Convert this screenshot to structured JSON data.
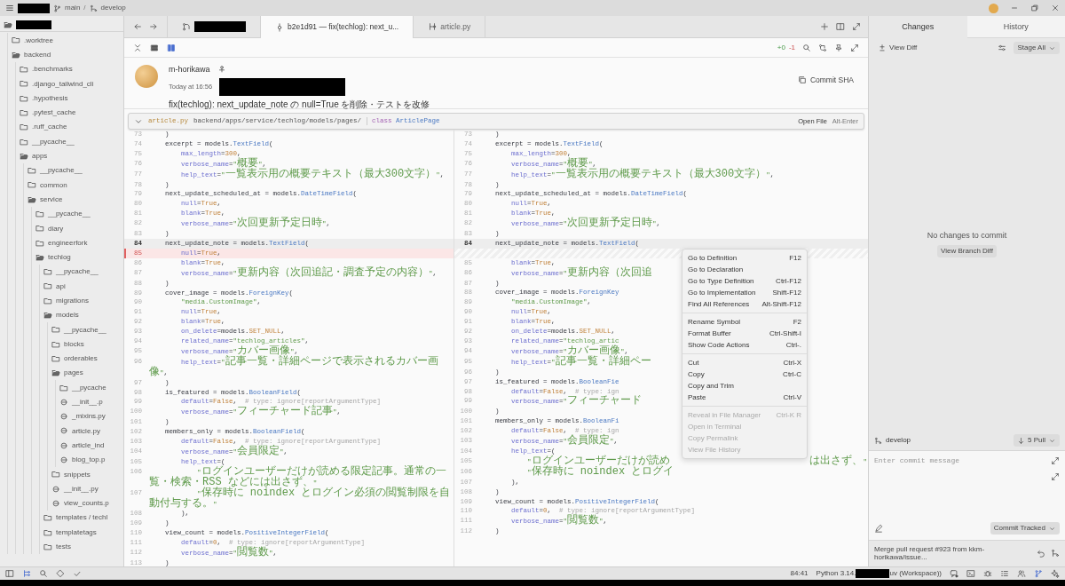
{
  "title_bar": {
    "branches": [
      {
        "name": "main",
        "kind": "current"
      },
      {
        "name": "develop",
        "kind": "upstream"
      }
    ],
    "separator": "/"
  },
  "project_tree": {
    "root": {
      "expanded": true,
      "children": [
        {
          "name": ".worktree",
          "kind": "folder",
          "expanded": false
        },
        {
          "name": "backend",
          "kind": "folder",
          "expanded": true,
          "children": [
            {
              "name": ".benchmarks",
              "kind": "folder",
              "expanded": false
            },
            {
              "name": ".django_tailwind_cli",
              "kind": "folder",
              "expanded": false
            },
            {
              "name": ".hypothesis",
              "kind": "folder",
              "expanded": false
            },
            {
              "name": ".pytest_cache",
              "kind": "folder",
              "expanded": false
            },
            {
              "name": ".ruff_cache",
              "kind": "folder",
              "expanded": false
            },
            {
              "name": "__pycache__",
              "kind": "folder",
              "expanded": false
            },
            {
              "name": "apps",
              "kind": "folder",
              "expanded": true,
              "children": [
                {
                  "name": "__pycache__",
                  "kind": "folder",
                  "expanded": false
                },
                {
                  "name": "common",
                  "kind": "folder",
                  "expanded": false
                },
                {
                  "name": "service",
                  "kind": "folder",
                  "expanded": true,
                  "children": [
                    {
                      "name": "__pycache__",
                      "kind": "folder",
                      "expanded": false
                    },
                    {
                      "name": "diary",
                      "kind": "folder",
                      "expanded": false
                    },
                    {
                      "name": "engineerfork",
                      "kind": "folder",
                      "expanded": false
                    },
                    {
                      "name": "techlog",
                      "kind": "folder",
                      "expanded": true,
                      "children": [
                        {
                          "name": "__pycache__",
                          "kind": "folder",
                          "expanded": false
                        },
                        {
                          "name": "api",
                          "kind": "folder",
                          "expanded": false
                        },
                        {
                          "name": "migrations",
                          "kind": "folder",
                          "expanded": false
                        },
                        {
                          "name": "models",
                          "kind": "folder",
                          "expanded": true,
                          "children": [
                            {
                              "name": "__pycache__",
                              "kind": "folder",
                              "expanded": false
                            },
                            {
                              "name": "blocks",
                              "kind": "folder",
                              "expanded": false
                            },
                            {
                              "name": "orderables",
                              "kind": "folder",
                              "expanded": false
                            },
                            {
                              "name": "pages",
                              "kind": "folder",
                              "expanded": true,
                              "children": [
                                {
                                  "name": "__pycache",
                                  "kind": "folder",
                                  "expanded": false
                                },
                                {
                                  "name": "__init__.p",
                                  "kind": "file"
                                },
                                {
                                  "name": "_mixins.py",
                                  "kind": "file"
                                },
                                {
                                  "name": "article.py",
                                  "kind": "file"
                                },
                                {
                                  "name": "article_ind",
                                  "kind": "file"
                                },
                                {
                                  "name": "blog_top.p",
                                  "kind": "file"
                                }
                              ]
                            },
                            {
                              "name": "snippets",
                              "kind": "folder",
                              "expanded": false
                            },
                            {
                              "name": "__init__.py",
                              "kind": "file"
                            },
                            {
                              "name": "view_counts.p",
                              "kind": "file"
                            }
                          ]
                        },
                        {
                          "name": "templates / techl",
                          "kind": "folder",
                          "expanded": false
                        },
                        {
                          "name": "templatetags",
                          "kind": "folder",
                          "expanded": false
                        },
                        {
                          "name": "tests",
                          "kind": "folder",
                          "expanded": false
                        }
                      ]
                    }
                  ]
                }
              ]
            }
          ]
        }
      ]
    }
  },
  "tabs": [
    {
      "kind": "repository",
      "selected": false
    },
    {
      "kind": "commit",
      "label": "b2e1d91 — fix(techlog): next_u...",
      "selected": true
    },
    {
      "kind": "file",
      "label": "article.py",
      "selected": false
    }
  ],
  "diff_stats": {
    "added": "+0",
    "removed": "-1"
  },
  "commit": {
    "author": "m-horikawa",
    "time": "Today at 16:56",
    "message": "fix(techlog): next_update_note の null=True を削除・テストを改修",
    "sha_button": "Commit SHA"
  },
  "breadcrumb": {
    "file": "article.py",
    "path": "backend/apps/service/techlog/models/pages/",
    "keyword": "class",
    "symbol": "ArticlePage",
    "open_label": "Open File",
    "open_shortcut": "Alt-Enter"
  },
  "left_pane": [
    {
      "n": "73",
      "kind": "normal",
      "tokens": [
        {
          "kind": "plain",
          "text": "    )"
        }
      ]
    },
    {
      "n": "74",
      "kind": "normal",
      "tokens": [
        {
          "kind": "plain",
          "text": "    excerpt = models."
        },
        {
          "kind": "type",
          "text": "TextField"
        },
        {
          "kind": "plain",
          "text": "("
        }
      ]
    },
    {
      "n": "75",
      "kind": "normal",
      "tokens": [
        {
          "kind": "attr",
          "text": "        max_length"
        },
        {
          "kind": "plain",
          "text": "="
        },
        {
          "kind": "num",
          "text": "300"
        },
        {
          "kind": "plain",
          "text": ","
        }
      ]
    },
    {
      "n": "76",
      "kind": "normal",
      "tokens": [
        {
          "kind": "attr",
          "text": "        verbose_name"
        },
        {
          "kind": "plain",
          "text": "="
        },
        {
          "kind": "str",
          "text": "\""
        },
        {
          "kind": "cjk",
          "text": "概要"
        },
        {
          "kind": "str",
          "text": "\""
        },
        {
          "kind": "plain",
          "text": ","
        }
      ]
    },
    {
      "n": "77",
      "kind": "normal",
      "tokens": [
        {
          "kind": "attr",
          "text": "        help_text"
        },
        {
          "kind": "plain",
          "text": "="
        },
        {
          "kind": "str",
          "text": "\""
        },
        {
          "kind": "cjk",
          "text": "一覧表示用の概要テキスト（最大300文字）"
        },
        {
          "kind": "str",
          "text": "\""
        },
        {
          "kind": "plain",
          "text": ","
        }
      ]
    },
    {
      "n": "78",
      "kind": "normal",
      "tokens": [
        {
          "kind": "plain",
          "text": "    )"
        }
      ]
    },
    {
      "n": "79",
      "kind": "normal",
      "tokens": [
        {
          "kind": "plain",
          "text": "    next_update_scheduled_at = models."
        },
        {
          "kind": "type",
          "text": "DateTimeField"
        },
        {
          "kind": "plain",
          "text": "("
        }
      ]
    },
    {
      "n": "80",
      "kind": "normal",
      "tokens": [
        {
          "kind": "attr",
          "text": "        null"
        },
        {
          "kind": "plain",
          "text": "="
        },
        {
          "kind": "num",
          "text": "True"
        },
        {
          "kind": "plain",
          "text": ","
        }
      ]
    },
    {
      "n": "81",
      "kind": "normal",
      "tokens": [
        {
          "kind": "attr",
          "text": "        blank"
        },
        {
          "kind": "plain",
          "text": "="
        },
        {
          "kind": "num",
          "text": "True"
        },
        {
          "kind": "plain",
          "text": ","
        }
      ]
    },
    {
      "n": "82",
      "kind": "normal",
      "tokens": [
        {
          "kind": "attr",
          "text": "        verbose_name"
        },
        {
          "kind": "plain",
          "text": "="
        },
        {
          "kind": "str",
          "text": "\""
        },
        {
          "kind": "cjk",
          "text": "次回更新予定日時"
        },
        {
          "kind": "str",
          "text": "\""
        },
        {
          "kind": "plain",
          "text": ","
        }
      ]
    },
    {
      "n": "83",
      "kind": "normal",
      "tokens": [
        {
          "kind": "plain",
          "text": "    )"
        }
      ]
    },
    {
      "n": "84",
      "kind": "current",
      "tokens": [
        {
          "kind": "plain",
          "text": "    next_update_note = models."
        },
        {
          "kind": "type",
          "text": "TextField"
        },
        {
          "kind": "plain",
          "text": "("
        }
      ]
    },
    {
      "n": "85",
      "kind": "deleted",
      "tokens": [
        {
          "kind": "attr",
          "text": "        null"
        },
        {
          "kind": "plain",
          "text": "="
        },
        {
          "kind": "num",
          "text": "True"
        },
        {
          "kind": "plain",
          "text": ","
        }
      ]
    },
    {
      "n": "86",
      "kind": "normal",
      "tokens": [
        {
          "kind": "attr",
          "text": "        blank"
        },
        {
          "kind": "plain",
          "text": "="
        },
        {
          "kind": "num",
          "text": "True"
        },
        {
          "kind": "plain",
          "text": ","
        }
      ]
    },
    {
      "n": "87",
      "kind": "normal",
      "tokens": [
        {
          "kind": "attr",
          "text": "        verbose_name"
        },
        {
          "kind": "plain",
          "text": "="
        },
        {
          "kind": "str",
          "text": "\""
        },
        {
          "kind": "cjk",
          "text": "更新内容（次回追記・調査予定の内容）"
        },
        {
          "kind": "str",
          "text": "\""
        },
        {
          "kind": "plain",
          "text": ","
        }
      ]
    },
    {
      "n": "88",
      "kind": "normal",
      "tokens": [
        {
          "kind": "plain",
          "text": "    )"
        }
      ]
    },
    {
      "n": "89",
      "kind": "normal",
      "tokens": [
        {
          "kind": "plain",
          "text": "    cover_image = models."
        },
        {
          "kind": "type",
          "text": "ForeignKey"
        },
        {
          "kind": "plain",
          "text": "("
        }
      ]
    },
    {
      "n": "90",
      "kind": "normal",
      "tokens": [
        {
          "kind": "str",
          "text": "        \"media.CustomImage\""
        },
        {
          "kind": "plain",
          "text": ","
        }
      ]
    },
    {
      "n": "91",
      "kind": "normal",
      "tokens": [
        {
          "kind": "attr",
          "text": "        null"
        },
        {
          "kind": "plain",
          "text": "="
        },
        {
          "kind": "num",
          "text": "True"
        },
        {
          "kind": "plain",
          "text": ","
        }
      ]
    },
    {
      "n": "92",
      "kind": "normal",
      "tokens": [
        {
          "kind": "attr",
          "text": "        blank"
        },
        {
          "kind": "plain",
          "text": "="
        },
        {
          "kind": "num",
          "text": "True"
        },
        {
          "kind": "plain",
          "text": ","
        }
      ]
    },
    {
      "n": "93",
      "kind": "normal",
      "tokens": [
        {
          "kind": "attr",
          "text": "        on_delete"
        },
        {
          "kind": "plain",
          "text": "=models."
        },
        {
          "kind": "num",
          "text": "SET_NULL"
        },
        {
          "kind": "plain",
          "text": ","
        }
      ]
    },
    {
      "n": "94",
      "kind": "normal",
      "tokens": [
        {
          "kind": "attr",
          "text": "        related_name"
        },
        {
          "kind": "plain",
          "text": "="
        },
        {
          "kind": "str",
          "text": "\"techlog_articles\""
        },
        {
          "kind": "plain",
          "text": ","
        }
      ]
    },
    {
      "n": "95",
      "kind": "normal",
      "tokens": [
        {
          "kind": "attr",
          "text": "        verbose_name"
        },
        {
          "kind": "plain",
          "text": "="
        },
        {
          "kind": "str",
          "text": "\""
        },
        {
          "kind": "cjk",
          "text": "カバー画像"
        },
        {
          "kind": "str",
          "text": "\""
        },
        {
          "kind": "plain",
          "text": ","
        }
      ]
    },
    {
      "n": "96",
      "kind": "normal",
      "tokens": [
        {
          "kind": "attr",
          "text": "        help_text"
        },
        {
          "kind": "plain",
          "text": "="
        },
        {
          "kind": "str",
          "text": "\""
        },
        {
          "kind": "cjk",
          "text": "記事一覧・詳細ページで表示されるカバー画像"
        },
        {
          "kind": "str",
          "text": "\""
        },
        {
          "kind": "plain",
          "text": ","
        }
      ]
    },
    {
      "n": "97",
      "kind": "normal",
      "tokens": [
        {
          "kind": "plain",
          "text": "    )"
        }
      ]
    },
    {
      "n": "98",
      "kind": "normal",
      "tokens": [
        {
          "kind": "plain",
          "text": "    is_featured = models."
        },
        {
          "kind": "type",
          "text": "BooleanField"
        },
        {
          "kind": "plain",
          "text": "("
        }
      ]
    },
    {
      "n": "99",
      "kind": "normal",
      "tokens": [
        {
          "kind": "attr",
          "text": "        default"
        },
        {
          "kind": "plain",
          "text": "="
        },
        {
          "kind": "num",
          "text": "False"
        },
        {
          "kind": "plain",
          "text": ",  "
        },
        {
          "kind": "comment",
          "text": "# type: ignore[reportArgumentType]"
        }
      ]
    },
    {
      "n": "100",
      "kind": "normal",
      "tokens": [
        {
          "kind": "attr",
          "text": "        verbose_name"
        },
        {
          "kind": "plain",
          "text": "="
        },
        {
          "kind": "str",
          "text": "\""
        },
        {
          "kind": "cjk",
          "text": "フィーチャード記事"
        },
        {
          "kind": "str",
          "text": "\""
        },
        {
          "kind": "plain",
          "text": ","
        }
      ]
    },
    {
      "n": "101",
      "kind": "normal",
      "tokens": [
        {
          "kind": "plain",
          "text": "    )"
        }
      ]
    },
    {
      "n": "102",
      "kind": "normal",
      "tokens": [
        {
          "kind": "plain",
          "text": "    members_only = models."
        },
        {
          "kind": "type",
          "text": "BooleanField"
        },
        {
          "kind": "plain",
          "text": "("
        }
      ]
    },
    {
      "n": "103",
      "kind": "normal",
      "tokens": [
        {
          "kind": "attr",
          "text": "        default"
        },
        {
          "kind": "plain",
          "text": "="
        },
        {
          "kind": "num",
          "text": "False"
        },
        {
          "kind": "plain",
          "text": ",  "
        },
        {
          "kind": "comment",
          "text": "# type: ignore[reportArgumentType]"
        }
      ]
    },
    {
      "n": "104",
      "kind": "normal",
      "tokens": [
        {
          "kind": "attr",
          "text": "        verbose_name"
        },
        {
          "kind": "plain",
          "text": "="
        },
        {
          "kind": "str",
          "text": "\""
        },
        {
          "kind": "cjk",
          "text": "会員限定"
        },
        {
          "kind": "str",
          "text": "\""
        },
        {
          "kind": "plain",
          "text": ","
        }
      ]
    },
    {
      "n": "105",
      "kind": "normal",
      "tokens": [
        {
          "kind": "attr",
          "text": "        help_text"
        },
        {
          "kind": "plain",
          "text": "=("
        }
      ]
    },
    {
      "n": "106",
      "kind": "normal",
      "tokens": [
        {
          "kind": "str",
          "text": "            \""
        },
        {
          "kind": "cjk",
          "text": "ログインユーザーだけが読める限定記事。通常の一覧・検索・RSS などには出さず、"
        },
        {
          "kind": "str",
          "text": "\""
        }
      ]
    },
    {
      "n": "107",
      "kind": "normal",
      "tokens": [
        {
          "kind": "str",
          "text": "            \""
        },
        {
          "kind": "cjk",
          "text": "保存時に noindex とログイン必須の閲覧制限を自動付与する。"
        },
        {
          "kind": "str",
          "text": "\""
        }
      ]
    },
    {
      "n": "108",
      "kind": "normal",
      "tokens": [
        {
          "kind": "plain",
          "text": "        ),"
        }
      ]
    },
    {
      "n": "109",
      "kind": "normal",
      "tokens": [
        {
          "kind": "plain",
          "text": "    )"
        }
      ]
    },
    {
      "n": "110",
      "kind": "normal",
      "tokens": [
        {
          "kind": "plain",
          "text": "    view_count = models."
        },
        {
          "kind": "type",
          "text": "PositiveIntegerField"
        },
        {
          "kind": "plain",
          "text": "("
        }
      ]
    },
    {
      "n": "111",
      "kind": "normal",
      "tokens": [
        {
          "kind": "attr",
          "text": "        default"
        },
        {
          "kind": "plain",
          "text": "="
        },
        {
          "kind": "num",
          "text": "0"
        },
        {
          "kind": "plain",
          "text": ",  "
        },
        {
          "kind": "comment",
          "text": "# type: ignore[reportArgumentType]"
        }
      ]
    },
    {
      "n": "112",
      "kind": "normal",
      "tokens": [
        {
          "kind": "attr",
          "text": "        verbose_name"
        },
        {
          "kind": "plain",
          "text": "="
        },
        {
          "kind": "str",
          "text": "\""
        },
        {
          "kind": "cjk",
          "text": "閲覧数"
        },
        {
          "kind": "str",
          "text": "\""
        },
        {
          "kind": "plain",
          "text": ","
        }
      ]
    },
    {
      "n": "113",
      "kind": "normal",
      "tokens": [
        {
          "kind": "plain",
          "text": "    )"
        }
      ]
    }
  ],
  "right_pane": [
    {
      "n": "73",
      "kind": "normal",
      "tokens": [
        {
          "kind": "plain",
          "text": "    )"
        }
      ]
    },
    {
      "n": "74",
      "kind": "normal",
      "tokens": [
        {
          "kind": "plain",
          "text": "    excerpt = models."
        },
        {
          "kind": "type",
          "text": "TextField"
        },
        {
          "kind": "plain",
          "text": "("
        }
      ]
    },
    {
      "n": "75",
      "kind": "normal",
      "tokens": [
        {
          "kind": "attr",
          "text": "        max_length"
        },
        {
          "kind": "plain",
          "text": "="
        },
        {
          "kind": "num",
          "text": "300"
        },
        {
          "kind": "plain",
          "text": ","
        }
      ]
    },
    {
      "n": "76",
      "kind": "normal",
      "tokens": [
        {
          "kind": "attr",
          "text": "        verbose_name"
        },
        {
          "kind": "plain",
          "text": "="
        },
        {
          "kind": "str",
          "text": "\""
        },
        {
          "kind": "cjk",
          "text": "概要"
        },
        {
          "kind": "str",
          "text": "\""
        },
        {
          "kind": "plain",
          "text": ","
        }
      ]
    },
    {
      "n": "77",
      "kind": "normal",
      "tokens": [
        {
          "kind": "attr",
          "text": "        help_text"
        },
        {
          "kind": "plain",
          "text": "="
        },
        {
          "kind": "str",
          "text": "\""
        },
        {
          "kind": "cjk",
          "text": "一覧表示用の概要テキスト（最大300文字）"
        },
        {
          "kind": "str",
          "text": "\""
        },
        {
          "kind": "plain",
          "text": ","
        }
      ]
    },
    {
      "n": "78",
      "kind": "normal",
      "tokens": [
        {
          "kind": "plain",
          "text": "    )"
        }
      ]
    },
    {
      "n": "79",
      "kind": "normal",
      "tokens": [
        {
          "kind": "plain",
          "text": "    next_update_scheduled_at = models."
        },
        {
          "kind": "type",
          "text": "DateTimeField"
        },
        {
          "kind": "plain",
          "text": "("
        }
      ]
    },
    {
      "n": "80",
      "kind": "normal",
      "tokens": [
        {
          "kind": "attr",
          "text": "        null"
        },
        {
          "kind": "plain",
          "text": "="
        },
        {
          "kind": "num",
          "text": "True"
        },
        {
          "kind": "plain",
          "text": ","
        }
      ]
    },
    {
      "n": "81",
      "kind": "normal",
      "tokens": [
        {
          "kind": "attr",
          "text": "        blank"
        },
        {
          "kind": "plain",
          "text": "="
        },
        {
          "kind": "num",
          "text": "True"
        },
        {
          "kind": "plain",
          "text": ","
        }
      ]
    },
    {
      "n": "82",
      "kind": "normal",
      "tokens": [
        {
          "kind": "attr",
          "text": "        verbose_name"
        },
        {
          "kind": "plain",
          "text": "="
        },
        {
          "kind": "str",
          "text": "\""
        },
        {
          "kind": "cjk",
          "text": "次回更新予定日時"
        },
        {
          "kind": "str",
          "text": "\""
        },
        {
          "kind": "plain",
          "text": ","
        }
      ]
    },
    {
      "n": "83",
      "kind": "normal",
      "tokens": [
        {
          "kind": "plain",
          "text": "    )"
        }
      ]
    },
    {
      "n": "84",
      "kind": "current",
      "tokens": [
        {
          "kind": "plain",
          "text": "    next_update_note = models."
        },
        {
          "kind": "type",
          "text": "TextField"
        },
        {
          "kind": "plain",
          "text": "("
        }
      ]
    },
    {
      "kind": "spacer"
    },
    {
      "n": "85",
      "kind": "normal",
      "tokens": [
        {
          "kind": "attr",
          "text": "        blank"
        },
        {
          "kind": "plain",
          "text": "="
        },
        {
          "kind": "num",
          "text": "True"
        },
        {
          "kind": "plain",
          "text": ","
        }
      ]
    },
    {
      "n": "86",
      "kind": "normal",
      "tokens": [
        {
          "kind": "attr",
          "text": "        verbose_name"
        },
        {
          "kind": "plain",
          "text": "="
        },
        {
          "kind": "str",
          "text": "\""
        },
        {
          "kind": "cjk",
          "text": "更新内容（次回追"
        }
      ]
    },
    {
      "n": "87",
      "kind": "normal",
      "tokens": [
        {
          "kind": "plain",
          "text": "    )"
        }
      ]
    },
    {
      "n": "88",
      "kind": "normal",
      "tokens": [
        {
          "kind": "plain",
          "text": "    cover_image = models."
        },
        {
          "kind": "type",
          "text": "ForeignKey"
        }
      ]
    },
    {
      "n": "89",
      "kind": "normal",
      "tokens": [
        {
          "kind": "str",
          "text": "        \"media.CustomImage\""
        },
        {
          "kind": "plain",
          "text": ","
        }
      ]
    },
    {
      "n": "90",
      "kind": "normal",
      "tokens": [
        {
          "kind": "attr",
          "text": "        null"
        },
        {
          "kind": "plain",
          "text": "="
        },
        {
          "kind": "num",
          "text": "True"
        },
        {
          "kind": "plain",
          "text": ","
        }
      ]
    },
    {
      "n": "91",
      "kind": "normal",
      "tokens": [
        {
          "kind": "attr",
          "text": "        blank"
        },
        {
          "kind": "plain",
          "text": "="
        },
        {
          "kind": "num",
          "text": "True"
        },
        {
          "kind": "plain",
          "text": ","
        }
      ]
    },
    {
      "n": "92",
      "kind": "normal",
      "tokens": [
        {
          "kind": "attr",
          "text": "        on_delete"
        },
        {
          "kind": "plain",
          "text": "=models."
        },
        {
          "kind": "num",
          "text": "SET_NULL"
        },
        {
          "kind": "plain",
          "text": ","
        }
      ]
    },
    {
      "n": "93",
      "kind": "normal",
      "tokens": [
        {
          "kind": "attr",
          "text": "        related_name"
        },
        {
          "kind": "plain",
          "text": "="
        },
        {
          "kind": "str",
          "text": "\"techlog_artic"
        }
      ]
    },
    {
      "n": "94",
      "kind": "normal",
      "tokens": [
        {
          "kind": "attr",
          "text": "        verbose_name"
        },
        {
          "kind": "plain",
          "text": "="
        },
        {
          "kind": "str",
          "text": "\""
        },
        {
          "kind": "cjk",
          "text": "カバー画像"
        },
        {
          "kind": "str",
          "text": "\""
        },
        {
          "kind": "plain",
          "text": ","
        }
      ]
    },
    {
      "n": "95",
      "kind": "normal",
      "tokens": [
        {
          "kind": "attr",
          "text": "        help_text"
        },
        {
          "kind": "plain",
          "text": "="
        },
        {
          "kind": "str",
          "text": "\""
        },
        {
          "kind": "cjk",
          "text": "記事一覧・詳細ペー"
        }
      ]
    },
    {
      "n": "96",
      "kind": "normal",
      "tokens": [
        {
          "kind": "plain",
          "text": "    )"
        }
      ]
    },
    {
      "n": "97",
      "kind": "normal",
      "tokens": [
        {
          "kind": "plain",
          "text": "    is_featured = models."
        },
        {
          "kind": "type",
          "text": "BooleanFie"
        }
      ]
    },
    {
      "n": "98",
      "kind": "normal",
      "tokens": [
        {
          "kind": "attr",
          "text": "        default"
        },
        {
          "kind": "plain",
          "text": "="
        },
        {
          "kind": "num",
          "text": "False"
        },
        {
          "kind": "plain",
          "text": ",  "
        },
        {
          "kind": "comment",
          "text": "# type: ign"
        }
      ]
    },
    {
      "n": "99",
      "kind": "normal",
      "tokens": [
        {
          "kind": "attr",
          "text": "        verbose_name"
        },
        {
          "kind": "plain",
          "text": "="
        },
        {
          "kind": "str",
          "text": "\""
        },
        {
          "kind": "cjk",
          "text": "フィーチャード"
        }
      ]
    },
    {
      "n": "100",
      "kind": "normal",
      "tokens": [
        {
          "kind": "plain",
          "text": "    )"
        }
      ]
    },
    {
      "n": "101",
      "kind": "normal",
      "tokens": [
        {
          "kind": "plain",
          "text": "    members_only = models."
        },
        {
          "kind": "type",
          "text": "BooleanFi"
        }
      ]
    },
    {
      "n": "102",
      "kind": "normal",
      "tokens": [
        {
          "kind": "attr",
          "text": "        default"
        },
        {
          "kind": "plain",
          "text": "="
        },
        {
          "kind": "num",
          "text": "False"
        },
        {
          "kind": "plain",
          "text": ",  "
        },
        {
          "kind": "comment",
          "text": "# type: ign"
        }
      ]
    },
    {
      "n": "103",
      "kind": "normal",
      "tokens": [
        {
          "kind": "attr",
          "text": "        verbose_name"
        },
        {
          "kind": "plain",
          "text": "="
        },
        {
          "kind": "str",
          "text": "\""
        },
        {
          "kind": "cjk",
          "text": "会員限定"
        },
        {
          "kind": "str",
          "text": "\""
        },
        {
          "kind": "plain",
          "text": ","
        }
      ]
    },
    {
      "n": "104",
      "kind": "normal",
      "tokens": [
        {
          "kind": "attr",
          "text": "        help_text"
        },
        {
          "kind": "plain",
          "text": "=("
        }
      ]
    },
    {
      "n": "105",
      "kind": "normal",
      "tokens": [
        {
          "kind": "str",
          "text": "            \""
        },
        {
          "kind": "cjk",
          "text": "ログインユーザーだけが読め"
        }
      ],
      "tail": [
        {
          "kind": "cjk",
          "text": "は出さず、"
        },
        {
          "kind": "str",
          "text": "\""
        }
      ]
    },
    {
      "n": "106",
      "kind": "normal",
      "tokens": [
        {
          "kind": "str",
          "text": "            \""
        },
        {
          "kind": "cjk",
          "text": "保存時に noindex とログイ"
        }
      ]
    },
    {
      "n": "107",
      "kind": "normal",
      "tokens": [
        {
          "kind": "plain",
          "text": "        ),"
        }
      ]
    },
    {
      "n": "108",
      "kind": "normal",
      "tokens": [
        {
          "kind": "plain",
          "text": "    )"
        }
      ]
    },
    {
      "n": "109",
      "kind": "normal",
      "tokens": [
        {
          "kind": "plain",
          "text": "    view_count = models."
        },
        {
          "kind": "type",
          "text": "PositiveIntegerField"
        },
        {
          "kind": "plain",
          "text": "("
        }
      ]
    },
    {
      "n": "110",
      "kind": "normal",
      "tokens": [
        {
          "kind": "attr",
          "text": "        default"
        },
        {
          "kind": "plain",
          "text": "="
        },
        {
          "kind": "num",
          "text": "0"
        },
        {
          "kind": "plain",
          "text": ",  "
        },
        {
          "kind": "comment",
          "text": "# type: ignore[reportArgumentType]"
        }
      ]
    },
    {
      "n": "111",
      "kind": "normal",
      "tokens": [
        {
          "kind": "attr",
          "text": "        verbose_name"
        },
        {
          "kind": "plain",
          "text": "="
        },
        {
          "kind": "str",
          "text": "\""
        },
        {
          "kind": "cjk",
          "text": "閲覧数"
        },
        {
          "kind": "str",
          "text": "\""
        },
        {
          "kind": "plain",
          "text": ","
        }
      ]
    },
    {
      "n": "112",
      "kind": "normal",
      "tokens": [
        {
          "kind": "plain",
          "text": "    )"
        }
      ]
    }
  ],
  "context_menu": {
    "groups": [
      [
        {
          "label": "Go to Definition",
          "shortcut": "F12",
          "disabled": false
        },
        {
          "label": "Go to Declaration",
          "disabled": false
        },
        {
          "label": "Go to Type Definition",
          "shortcut": "Ctrl-F12",
          "disabled": false
        },
        {
          "label": "Go to Implementation",
          "shortcut": "Shift-F12",
          "disabled": false
        },
        {
          "label": "Find All References",
          "shortcut": "Alt-Shift-F12",
          "disabled": false
        }
      ],
      [
        {
          "label": "Rename Symbol",
          "shortcut": "F2",
          "disabled": false
        },
        {
          "label": "Format Buffer",
          "shortcut": "Ctrl-Shift-I",
          "disabled": false
        },
        {
          "label": "Show Code Actions",
          "shortcut": "Ctrl-.",
          "disabled": false
        }
      ],
      [
        {
          "label": "Cut",
          "shortcut": "Ctrl-X",
          "disabled": false
        },
        {
          "label": "Copy",
          "shortcut": "Ctrl-C",
          "disabled": false
        },
        {
          "label": "Copy and Trim",
          "disabled": false
        },
        {
          "label": "Paste",
          "shortcut": "Ctrl-V",
          "disabled": false
        }
      ],
      [
        {
          "label": "Reveal in File Manager",
          "shortcut": "Ctrl-K  R",
          "disabled": true
        },
        {
          "label": "Open in Terminal",
          "disabled": true
        },
        {
          "label": "Copy Permalink",
          "disabled": true
        },
        {
          "label": "View File History",
          "disabled": true
        }
      ]
    ]
  },
  "git_panel": {
    "tabs": [
      {
        "label": "Changes",
        "selected": true
      },
      {
        "label": "History",
        "selected": false
      }
    ],
    "view_diff": "View Diff",
    "stage_all": "Stage All",
    "empty_message": "No changes to commit",
    "branch_diff": "View Branch Diff",
    "branch": "develop",
    "pull_count": "5",
    "pull_label": "Pull",
    "commit_placeholder": "Enter commit message",
    "commit_button": "Commit Tracked",
    "last_commit": "Merge pull request #923 from kkm-horikawa/issue..."
  },
  "status_bar": {
    "cursor": "84:41",
    "python": "Python 3.14.",
    "environment": "uv (Workspace))"
  }
}
